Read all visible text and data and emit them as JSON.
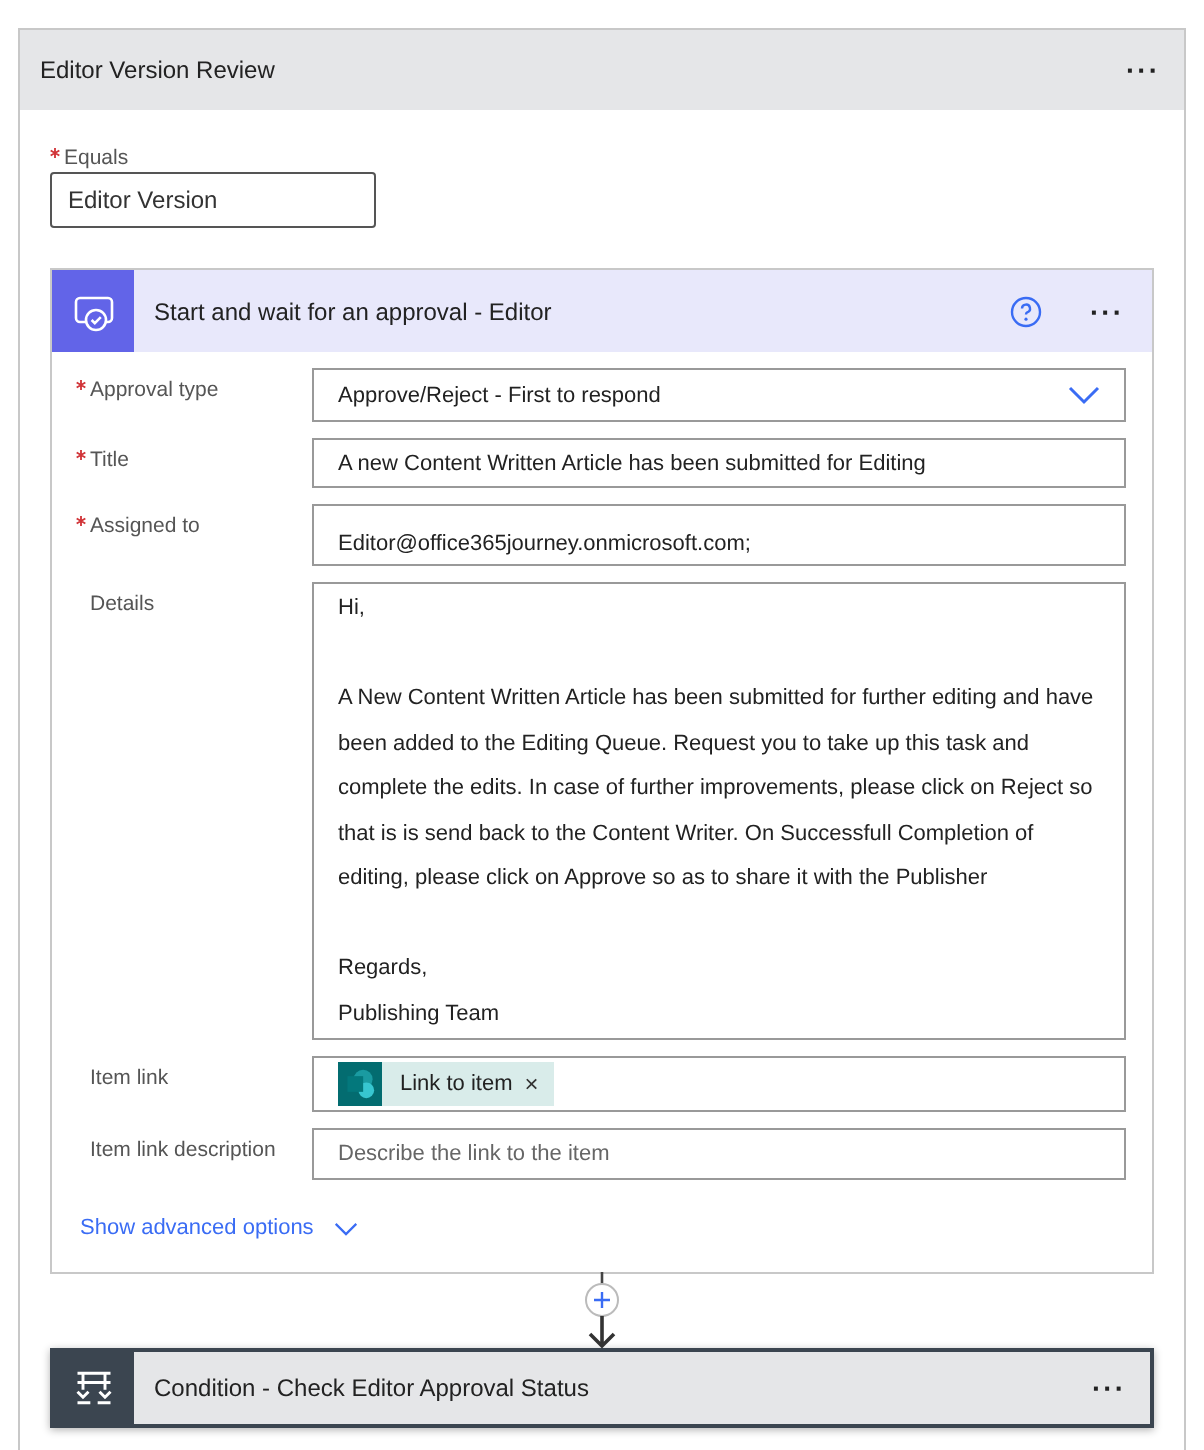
{
  "scope": {
    "title": "Editor Version Review",
    "menu": "···"
  },
  "equals": {
    "label": "Equals",
    "required": true,
    "value": "Editor Version"
  },
  "action": {
    "title": "Start and wait for an approval - Editor",
    "menu": "···",
    "fields": [
      {
        "kind": "dropdown",
        "label": "Approval type",
        "required": true,
        "value": "Approve/Reject - First to respond"
      },
      {
        "kind": "text",
        "label": "Title",
        "required": true,
        "value": "A new Content Written Article has been submitted for Editing"
      },
      {
        "kind": "tall",
        "label": "Assigned to",
        "required": true,
        "value": "Editor@office365journey.onmicrosoft.com;"
      },
      {
        "kind": "multiline",
        "label": "Details",
        "required": false,
        "paragraphs": [
          "Hi,",
          "A New Content Written Article has been submitted for further editing and have been added to the Editing Queue. Request you to take up this task and complete the edits. In case of further improvements, please click on Reject so that is is send back to the Content Writer. On Successfull Completion of editing, please click on Approve so as to share it with the Publisher",
          "Regards,\nPublishing Team"
        ]
      },
      {
        "kind": "chip",
        "label": "Item link",
        "required": false,
        "chip": "Link to item",
        "remove": "×"
      },
      {
        "kind": "placeholder",
        "label": "Item link description",
        "required": false,
        "placeholder": "Describe the link to the item"
      }
    ],
    "advanced": "Show advanced options"
  },
  "condition": {
    "title": "Condition - Check Editor Approval Status",
    "menu": "···"
  }
}
